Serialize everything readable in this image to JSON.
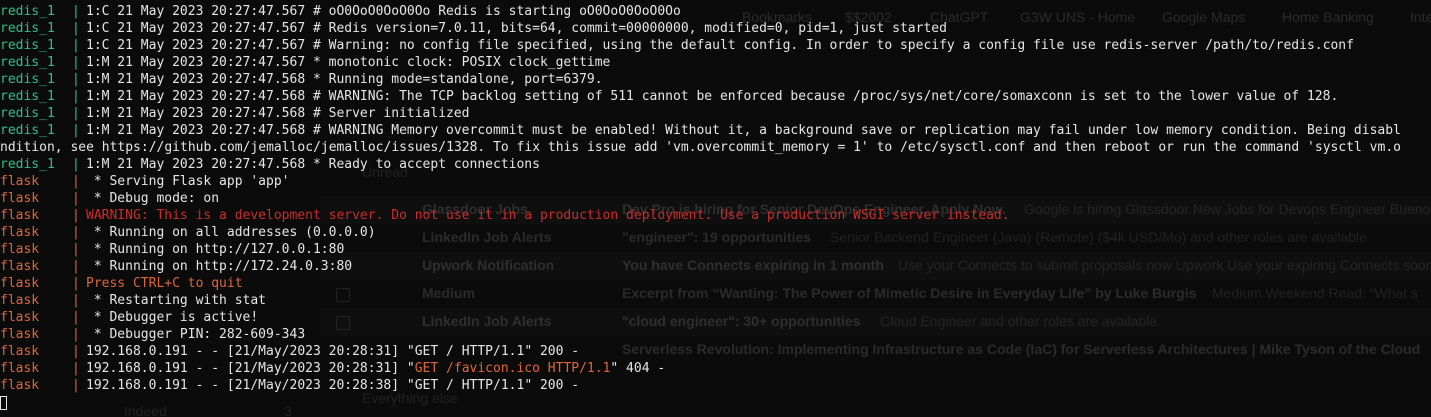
{
  "background_browser": {
    "bookmarks": [
      "Bookmarks",
      "$$2002",
      "ChatGPT",
      "G3W UNS - Home",
      "Google Maps",
      "Home Banking",
      "Inte"
    ],
    "section_label": "Unread",
    "rows": [
      {
        "sender": "Glassdoor Jobs",
        "subject": "Dev Pro is hiring for Senior DevOps Engineer. Apply Now.",
        "preview": "Google is hiring Glassdoor New Jobs for Devops Engineer Buenos"
      },
      {
        "sender": "LinkedIn Job Alerts",
        "subject": "\"engineer\": 19 opportunities",
        "preview": "Senior Backend Engineer (Java) (Remote) ($4k USD/Mo) and other roles are available"
      },
      {
        "sender": "Upwork Notification",
        "subject": "You have Connects expiring in 1 month",
        "preview": "Use your Connects to submit proposals now Upwork Use your expiring Connects soon"
      },
      {
        "sender": "Medium",
        "subject": "Excerpt from “Wanting: The Power of Mimetic Desire in Everyday Life” by Luke Burgis",
        "preview": "Medium Weekend Read: “What s"
      },
      {
        "sender": "LinkedIn Job Alerts",
        "subject": "\"cloud engineer\": 30+ opportunities",
        "preview": "Cloud Engineer and other roles are available"
      },
      {
        "sender": "",
        "subject": "Serverless Revolution: Implementing Infrastructure as Code (IaC) for Serverless Architectures | Mike Tyson of the Cloud",
        "preview": ""
      }
    ],
    "section_label_2": "Everything else",
    "sidebar_item": "Indeed",
    "sidebar_count": "3"
  },
  "terminal": {
    "lines": [
      {
        "service": "redis_1",
        "kind": "redis",
        "text": "1:C 21 May 2023 20:27:47.567 # oO0OoO0OoO0Oo Redis is starting oO0OoO0OoO0Oo"
      },
      {
        "service": "redis_1",
        "kind": "redis",
        "text": "1:C 21 May 2023 20:27:47.567 # Redis version=7.0.11, bits=64, commit=00000000, modified=0, pid=1, just started"
      },
      {
        "service": "redis_1",
        "kind": "redis",
        "text": "1:C 21 May 2023 20:27:47.567 # Warning: no config file specified, using the default config. In order to specify a config file use redis-server /path/to/redis.conf"
      },
      {
        "service": "redis_1",
        "kind": "redis",
        "text": "1:M 21 May 2023 20:27:47.567 * monotonic clock: POSIX clock_gettime"
      },
      {
        "service": "redis_1",
        "kind": "redis",
        "text": "1:M 21 May 2023 20:27:47.568 * Running mode=standalone, port=6379."
      },
      {
        "service": "redis_1",
        "kind": "redis",
        "text": "1:M 21 May 2023 20:27:47.568 # WARNING: The TCP backlog setting of 511 cannot be enforced because /proc/sys/net/core/somaxconn is set to the lower value of 128."
      },
      {
        "service": "redis_1",
        "kind": "redis",
        "text": "1:M 21 May 2023 20:27:47.568 # Server initialized"
      },
      {
        "service": "redis_1",
        "kind": "redis",
        "text": "1:M 21 May 2023 20:27:47.568 # WARNING Memory overcommit must be enabled! Without it, a background save or replication may fail under low memory condition. Being disabl"
      },
      {
        "service": "",
        "kind": "wrap",
        "text": "ndition, see https://github.com/jemalloc/jemalloc/issues/1328. To fix this issue add 'vm.overcommit_memory = 1' to /etc/sysctl.conf and then reboot or run the command 'sysctl vm.o"
      },
      {
        "service": "redis_1",
        "kind": "redis",
        "text": "1:M 21 May 2023 20:27:47.568 * Ready to accept connections"
      },
      {
        "service": "flask",
        "kind": "flask",
        "text": " * Serving Flask app 'app'"
      },
      {
        "service": "flask",
        "kind": "flask",
        "text": " * Debug mode: on"
      },
      {
        "service": "flask",
        "kind": "flask-warn",
        "text": "WARNING: This is a development server. Do not use it in a production deployment. Use a production WSGI server instead."
      },
      {
        "service": "flask",
        "kind": "flask",
        "text": " * Running on all addresses (0.0.0.0)"
      },
      {
        "service": "flask",
        "kind": "flask",
        "text": " * Running on http://127.0.0.1:80"
      },
      {
        "service": "flask",
        "kind": "flask",
        "text": " * Running on http://172.24.0.3:80"
      },
      {
        "service": "flask",
        "kind": "flask-quit",
        "text": "Press CTRL+C to quit"
      },
      {
        "service": "flask",
        "kind": "flask",
        "text": " * Restarting with stat"
      },
      {
        "service": "flask",
        "kind": "flask",
        "text": " * Debugger is active!"
      },
      {
        "service": "flask",
        "kind": "flask",
        "text": " * Debugger PIN: 282-609-343"
      },
      {
        "service": "flask",
        "kind": "access",
        "text_before": "192.168.0.191 - - [21/May/2023 20:28:31] \"",
        "request": "GET / HTTP/1.1",
        "text_after": "\" 200 -",
        "request_error": false
      },
      {
        "service": "flask",
        "kind": "access",
        "text_before": "192.168.0.191 - - [21/May/2023 20:28:31] \"",
        "request": "GET /favicon.ico HTTP/1.1",
        "text_after": "\" 404 -",
        "request_error": true
      },
      {
        "service": "flask",
        "kind": "access",
        "text_before": "192.168.0.191 - - [21/May/2023 20:28:38] \"",
        "request": "GET / HTTP/1.1",
        "text_after": "\" 200 -",
        "request_error": false
      }
    ]
  },
  "colors": {
    "redis": "#2fbf8a",
    "flask": "#e0663a",
    "warning": "#cc2b2b",
    "text": "#e6e6e6",
    "background": "#0b0b0b"
  }
}
